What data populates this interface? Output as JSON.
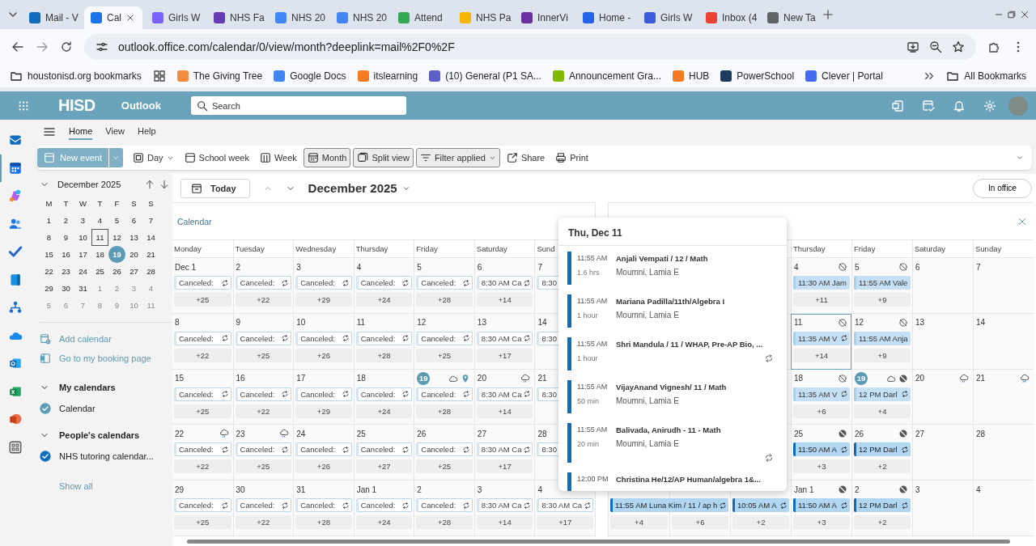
{
  "browser": {
    "tabs": [
      {
        "title": "Mail - V",
        "color": "#0f6cbd",
        "selected": false
      },
      {
        "title": "Cal",
        "color": "#1a73e8",
        "selected": true
      },
      {
        "title": "Girls W",
        "color": "#7b61ff",
        "selected": false
      },
      {
        "title": "NHS Fa",
        "color": "#673ab7",
        "selected": false
      },
      {
        "title": "NHS 20",
        "color": "#4285f4",
        "selected": false
      },
      {
        "title": "NHS 20",
        "color": "#4285f4",
        "selected": false
      },
      {
        "title": "Attend",
        "color": "#34a853",
        "selected": false
      },
      {
        "title": "NHS Pa",
        "color": "#f4b400",
        "selected": false
      },
      {
        "title": "InnerVi",
        "color": "#6b2fa0",
        "selected": false
      },
      {
        "title": "Home -",
        "color": "#2563eb",
        "selected": false
      },
      {
        "title": "Girls W",
        "color": "#3b5bdb",
        "selected": false
      },
      {
        "title": "Inbox (4",
        "color": "#ea4335",
        "selected": false
      },
      {
        "title": "New Ta",
        "color": "#5f6368",
        "selected": false
      }
    ],
    "url": "outlook.office.com/calendar/0/view/month?deeplink=mail%2F0%2F",
    "bookmarks": [
      {
        "kind": "folder",
        "label": "houstonisd.org bookmarks"
      },
      {
        "kind": "apps"
      },
      {
        "kind": "site",
        "label": "The Giving Tree",
        "color": "#f28b3c"
      },
      {
        "kind": "site",
        "label": "Google Docs",
        "color": "#4285f4"
      },
      {
        "kind": "site",
        "label": "itslearning",
        "color": "#f47b20"
      },
      {
        "kind": "site",
        "label": "(10) General (P1 SA...",
        "color": "#5b5fc7"
      },
      {
        "kind": "site",
        "label": "Announcement Gra...",
        "color": "#7fba00"
      },
      {
        "kind": "site",
        "label": "HUB",
        "color": "#f47b20"
      },
      {
        "kind": "site",
        "label": "PowerSchool",
        "color": "#1f3a5f"
      },
      {
        "kind": "site",
        "label": "Clever | Portal",
        "color": "#436cf2"
      }
    ],
    "all_bookmarks": "All Bookmarks"
  },
  "header": {
    "logo": "HISD",
    "app": "Outlook",
    "search_placeholder": "Search"
  },
  "rail": [
    {
      "kind": "mail",
      "selected": false
    },
    {
      "kind": "calendar",
      "selected": true
    },
    {
      "kind": "copilot",
      "selected": false
    },
    {
      "kind": "people",
      "selected": false
    },
    {
      "kind": "todo",
      "selected": false
    },
    {
      "kind": "book",
      "selected": false
    },
    {
      "kind": "org",
      "selected": false
    },
    {
      "kind": "onedrive",
      "selected": false
    },
    {
      "kind": "outlook",
      "selected": false
    },
    {
      "kind": "excel",
      "selected": false
    },
    {
      "kind": "powerpoint",
      "selected": false
    },
    {
      "kind": "apps",
      "selected": false
    }
  ],
  "ribbon_tabs": [
    {
      "label": "Home",
      "selected": true
    },
    {
      "label": "View",
      "selected": false
    },
    {
      "label": "Help",
      "selected": false
    }
  ],
  "toolbar": {
    "new_event": "New event",
    "items": [
      {
        "label": "Day",
        "kind": "day",
        "dropdown": true,
        "selected": false
      },
      {
        "label": "School week",
        "kind": "schoolweek",
        "dropdown": false,
        "selected": false
      },
      {
        "label": "Week",
        "kind": "week",
        "dropdown": false,
        "selected": false
      },
      {
        "label": "Month",
        "kind": "month",
        "dropdown": false,
        "selected": true
      },
      {
        "label": "Split view",
        "kind": "split",
        "dropdown": false,
        "selected": true
      },
      {
        "label": "Filter applied",
        "kind": "filter",
        "dropdown": true,
        "selected": true
      },
      {
        "label": "Share",
        "kind": "share",
        "dropdown": false,
        "selected": false
      },
      {
        "label": "Print",
        "kind": "print",
        "dropdown": false,
        "selected": false
      }
    ]
  },
  "mini_calendar": {
    "title": "December 2025",
    "weekdays": [
      "M",
      "T",
      "W",
      "T",
      "F",
      "S",
      "S"
    ],
    "weeks": [
      [
        {
          "day": "1",
          "outside": false,
          "today": false,
          "selected": false
        },
        {
          "day": "2",
          "outside": false,
          "today": false,
          "selected": false
        },
        {
          "day": "3",
          "outside": false,
          "today": false,
          "selected": false
        },
        {
          "day": "4",
          "outside": false,
          "today": false,
          "selected": false
        },
        {
          "day": "5",
          "outside": false,
          "today": false,
          "selected": false
        },
        {
          "day": "6",
          "outside": false,
          "today": false,
          "selected": false
        },
        {
          "day": "7",
          "outside": false,
          "today": false,
          "selected": false
        }
      ],
      [
        {
          "day": "8",
          "outside": false,
          "today": false,
          "selected": false
        },
        {
          "day": "9",
          "outside": false,
          "today": false,
          "selected": false
        },
        {
          "day": "10",
          "outside": false,
          "today": false,
          "selected": false
        },
        {
          "day": "11",
          "outside": false,
          "today": false,
          "selected": true
        },
        {
          "day": "12",
          "outside": false,
          "today": false,
          "selected": false
        },
        {
          "day": "13",
          "outside": false,
          "today": false,
          "selected": false
        },
        {
          "day": "14",
          "outside": false,
          "today": false,
          "selected": false
        }
      ],
      [
        {
          "day": "15",
          "outside": false,
          "today": false,
          "selected": false
        },
        {
          "day": "16",
          "outside": false,
          "today": false,
          "selected": false
        },
        {
          "day": "17",
          "outside": false,
          "today": false,
          "selected": false
        },
        {
          "day": "18",
          "outside": false,
          "today": false,
          "selected": false
        },
        {
          "day": "19",
          "outside": false,
          "today": true,
          "selected": false
        },
        {
          "day": "20",
          "outside": false,
          "today": false,
          "selected": false
        },
        {
          "day": "21",
          "outside": false,
          "today": false,
          "selected": false
        }
      ],
      [
        {
          "day": "22",
          "outside": false,
          "today": false,
          "selected": false
        },
        {
          "day": "23",
          "outside": false,
          "today": false,
          "selected": false
        },
        {
          "day": "24",
          "outside": false,
          "today": false,
          "selected": false
        },
        {
          "day": "25",
          "outside": false,
          "today": false,
          "selected": false
        },
        {
          "day": "26",
          "outside": false,
          "today": false,
          "selected": false
        },
        {
          "day": "27",
          "outside": false,
          "today": false,
          "selected": false
        },
        {
          "day": "28",
          "outside": false,
          "today": false,
          "selected": false
        }
      ],
      [
        {
          "day": "29",
          "outside": false,
          "today": false,
          "selected": false
        },
        {
          "day": "30",
          "outside": false,
          "today": false,
          "selected": false
        },
        {
          "day": "31",
          "outside": false,
          "today": false,
          "selected": false
        },
        {
          "day": "1",
          "outside": true,
          "today": false,
          "selected": false
        },
        {
          "day": "2",
          "outside": true,
          "today": false,
          "selected": false
        },
        {
          "day": "3",
          "outside": true,
          "today": false,
          "selected": false
        },
        {
          "day": "4",
          "outside": true,
          "today": false,
          "selected": false
        }
      ],
      [
        {
          "day": "5",
          "outside": true,
          "today": false,
          "selected": false
        },
        {
          "day": "6",
          "outside": true,
          "today": false,
          "selected": false
        },
        {
          "day": "7",
          "outside": true,
          "today": false,
          "selected": false
        },
        {
          "day": "8",
          "outside": true,
          "today": false,
          "selected": false
        },
        {
          "day": "9",
          "outside": true,
          "today": false,
          "selected": false
        },
        {
          "day": "10",
          "outside": true,
          "today": false,
          "selected": false
        },
        {
          "day": "11",
          "outside": true,
          "today": false,
          "selected": false
        }
      ]
    ]
  },
  "links": [
    {
      "label": "Add calendar",
      "kind": "addcal"
    },
    {
      "label": "Go to my booking page",
      "kind": "booking"
    }
  ],
  "calendar_groups": [
    {
      "title": "My calendars",
      "expanded": true,
      "calendars": [
        {
          "name": "Calendar",
          "checked": true,
          "color": "#5b9bb4"
        }
      ]
    },
    {
      "title": "People's calendars",
      "expanded": true,
      "calendars": [
        {
          "name": "NHS tutoring calendar...",
          "checked": true,
          "color": "#0f6cbd"
        }
      ]
    }
  ],
  "show_all": "Show all",
  "main": {
    "today": "Today",
    "title": "December 2025",
    "status": "In office"
  },
  "left_panel": {
    "label": "Calendar",
    "weekdays": [
      "Monday",
      "Tuesday",
      "Wednesday",
      "Thursday",
      "Friday",
      "Saturday",
      "Sund"
    ],
    "weeks": [
      [
        {
          "day": "Dec 1",
          "today": false,
          "selected": false,
          "event": {
            "text": "Canceled:",
            "kind": "outline",
            "recurring": true
          },
          "more": "+25"
        },
        {
          "day": "2",
          "today": false,
          "selected": false,
          "event": {
            "text": "Canceled:",
            "kind": "outline",
            "recurring": true
          },
          "more": "+22"
        },
        {
          "day": "3",
          "today": false,
          "selected": false,
          "event": {
            "text": "Canceled:",
            "kind": "outline",
            "recurring": true
          },
          "more": "+29"
        },
        {
          "day": "4",
          "today": false,
          "selected": false,
          "event": {
            "text": "Canceled:",
            "kind": "outline",
            "recurring": true
          },
          "more": "+24"
        },
        {
          "day": "5",
          "today": false,
          "selected": false,
          "event": {
            "text": "Canceled:",
            "kind": "outline",
            "recurring": true
          },
          "more": "+28"
        },
        {
          "day": "6",
          "today": false,
          "selected": false,
          "event": {
            "text": "8:30 AM Ca",
            "kind": "outline",
            "recurring": true
          },
          "more": "+14"
        },
        {
          "day": "7",
          "today": false,
          "selected": false,
          "event": {
            "text": "8:30",
            "kind": "outline"
          }
        }
      ],
      [
        {
          "day": "8",
          "today": false,
          "selected": false,
          "event": {
            "text": "Canceled:",
            "kind": "outline",
            "recurring": true
          },
          "more": "+22"
        },
        {
          "day": "9",
          "today": false,
          "selected": false,
          "event": {
            "text": "Canceled:",
            "kind": "outline",
            "recurring": true
          },
          "more": "+25"
        },
        {
          "day": "10",
          "today": false,
          "selected": false,
          "event": {
            "text": "Canceled:",
            "kind": "outline",
            "recurring": true
          },
          "more": "+26"
        },
        {
          "day": "11",
          "today": false,
          "selected": false,
          "event": {
            "text": "Canceled:",
            "kind": "outline",
            "recurring": true
          },
          "more": "+28"
        },
        {
          "day": "12",
          "today": false,
          "selected": false,
          "event": {
            "text": "Canceled:",
            "kind": "outline",
            "recurring": true
          },
          "more": "+25"
        },
        {
          "day": "13",
          "today": false,
          "selected": false,
          "event": {
            "text": "8:30 AM Ca",
            "kind": "outline",
            "recurring": true
          },
          "more": "+17"
        },
        {
          "day": "14",
          "today": false,
          "selected": false,
          "event": {
            "text": "8:30",
            "kind": "outline"
          }
        }
      ],
      [
        {
          "day": "15",
          "today": false,
          "selected": false,
          "event": {
            "text": "Canceled:",
            "kind": "outline",
            "recurring": true
          },
          "more": "+25"
        },
        {
          "day": "16",
          "today": false,
          "selected": false,
          "event": {
            "text": "Canceled:",
            "kind": "outline",
            "recurring": true
          },
          "more": "+22"
        },
        {
          "day": "17",
          "today": false,
          "selected": false,
          "event": {
            "text": "Canceled:",
            "kind": "outline",
            "recurring": true
          },
          "more": "+29"
        },
        {
          "day": "18",
          "today": false,
          "selected": false,
          "event": {
            "text": "Canceled:",
            "kind": "outline",
            "recurring": true
          },
          "more": "+24"
        },
        {
          "day": "19",
          "today": true,
          "selected": false,
          "icons": [
            {
              "kind": "cloud"
            },
            {
              "kind": "pin"
            }
          ],
          "event": {
            "text": "Canceled:",
            "kind": "outline",
            "recurring": true
          },
          "more": "+28"
        },
        {
          "day": "20",
          "today": false,
          "selected": false,
          "icons": [
            {
              "kind": "rain"
            }
          ],
          "event": {
            "text": "8:30 AM Ca",
            "kind": "outline",
            "recurring": true
          },
          "more": "+14"
        },
        {
          "day": "21",
          "today": false,
          "selected": false,
          "event": {
            "text": "8:30",
            "kind": "outline"
          }
        }
      ],
      [
        {
          "day": "22",
          "today": false,
          "selected": false,
          "icons": [
            {
              "kind": "rain"
            }
          ],
          "event": {
            "text": "Canceled:",
            "kind": "outline",
            "recurring": true
          },
          "more": "+22"
        },
        {
          "day": "23",
          "today": false,
          "selected": false,
          "icons": [
            {
              "kind": "rain"
            }
          ],
          "event": {
            "text": "Canceled:",
            "kind": "outline",
            "recurring": true
          },
          "more": "+25"
        },
        {
          "day": "24",
          "today": false,
          "selected": false,
          "event": {
            "text": "Canceled:",
            "kind": "outline",
            "recurring": true
          },
          "more": "+26"
        },
        {
          "day": "25",
          "today": false,
          "selected": false,
          "event": {
            "text": "Canceled:",
            "kind": "outline",
            "recurring": true
          },
          "more": "+27"
        },
        {
          "day": "26",
          "today": false,
          "selected": false,
          "event": {
            "text": "Canceled:",
            "kind": "outline",
            "recurring": true
          },
          "more": "+25"
        },
        {
          "day": "27",
          "today": false,
          "selected": false,
          "event": {
            "text": "8:30 AM Ca",
            "kind": "outline",
            "recurring": true
          },
          "more": "+17"
        },
        {
          "day": "28",
          "today": false,
          "selected": false,
          "event": {
            "text": "8:30",
            "kind": "outline"
          }
        }
      ],
      [
        {
          "day": "29",
          "today": false,
          "selected": false,
          "event": {
            "text": "Canceled:",
            "kind": "outline",
            "recurring": true
          },
          "more": "+25"
        },
        {
          "day": "30",
          "today": false,
          "selected": false,
          "event": {
            "text": "Canceled:",
            "kind": "outline",
            "recurring": true
          },
          "more": "+22"
        },
        {
          "day": "31",
          "today": false,
          "selected": false,
          "event": {
            "text": "Canceled:",
            "kind": "outline",
            "recurring": true
          },
          "more": "+28"
        },
        {
          "day": "Jan 1",
          "today": false,
          "selected": false,
          "event": {
            "text": "Canceled:",
            "kind": "outline",
            "recurring": true
          },
          "more": "+24"
        },
        {
          "day": "2",
          "today": false,
          "selected": false,
          "event": {
            "text": "Canceled:",
            "kind": "outline",
            "recurring": true
          },
          "more": "+28"
        },
        {
          "day": "3",
          "today": false,
          "selected": false,
          "event": {
            "text": "8:30 AM Ca",
            "kind": "outline",
            "recurring": true
          },
          "more": "+14"
        },
        {
          "day": "4",
          "today": false,
          "selected": false,
          "event": {
            "text": "8:30 AM Ca",
            "kind": "outline",
            "recurring": true
          },
          "more": "+17"
        }
      ]
    ]
  },
  "right_panel": {
    "weekdays": [
      "Thursday",
      "Friday",
      "Saturday",
      "Sunday"
    ],
    "weeks": [
      [
        {
          "day": "4",
          "today": false,
          "selected": false,
          "icons": [
            {
              "kind": "blocked"
            }
          ],
          "event": {
            "text": "11:30 AM Jam",
            "kind": "light"
          },
          "more": "+11"
        },
        {
          "day": "5",
          "today": false,
          "selected": false,
          "icons": [
            {
              "kind": "blocked"
            }
          ],
          "event": {
            "text": "11:55 AM Vale",
            "kind": "light"
          },
          "more": "+9"
        },
        {
          "day": "6",
          "today": false,
          "selected": false
        },
        {
          "day": "7",
          "today": false,
          "selected": false
        }
      ],
      [
        {
          "day": "11",
          "today": false,
          "selected": true,
          "icons": [
            {
              "kind": "blocked"
            }
          ],
          "event": {
            "text": "11:35 AM V",
            "kind": "light",
            "recurring": true
          },
          "more": "+14"
        },
        {
          "day": "12",
          "today": false,
          "selected": false,
          "icons": [
            {
              "kind": "blocked"
            }
          ],
          "event": {
            "text": "11:55 AM Anja",
            "kind": "light"
          },
          "more": "+9"
        },
        {
          "day": "13",
          "today": false,
          "selected": false
        },
        {
          "day": "14",
          "today": false,
          "selected": false
        }
      ],
      [
        {
          "day": "18",
          "today": false,
          "selected": false,
          "icons": [
            {
              "kind": "blocked"
            }
          ],
          "event": {
            "text": "11:35 AM V",
            "kind": "light",
            "recurring": true
          },
          "more": "+6"
        },
        {
          "day": "19",
          "today": true,
          "selected": false,
          "icons": [
            {
              "kind": "cloud"
            },
            {
              "kind": "blockedfill"
            }
          ],
          "event": {
            "text": "12 PM Darl",
            "kind": "light",
            "recurring": true
          },
          "more": "+4"
        },
        {
          "day": "20",
          "today": false,
          "selected": false,
          "icons": [
            {
              "kind": "rain"
            }
          ]
        },
        {
          "day": "21",
          "today": false,
          "selected": false,
          "icons": [
            {
              "kind": "rain"
            }
          ]
        }
      ],
      [
        {
          "day": "25",
          "today": false,
          "selected": false,
          "icons": [
            {
              "kind": "blockedfill"
            }
          ],
          "event": {
            "text": "11:50 AM A",
            "kind": "solid",
            "recurring": true
          },
          "more": "+3"
        },
        {
          "day": "26",
          "today": false,
          "selected": false,
          "icons": [
            {
              "kind": "blockedfill"
            }
          ],
          "event": {
            "text": "12 PM Darl",
            "kind": "solid",
            "recurring": true
          },
          "more": "+2"
        },
        {
          "day": "27",
          "today": false,
          "selected": false
        },
        {
          "day": "28",
          "today": false,
          "selected": false
        }
      ],
      [
        {
          "selected": false,
          "event": {
            "text": "11:55 AM Luna Kim / 11 / ap h",
            "kind": "solid",
            "recurring": true,
            "wide": true
          },
          "more": "+4"
        },
        {
          "selected": false,
          "more": "+6"
        },
        {
          "selected": false,
          "event": {
            "text": "10:05 AM A",
            "kind": "solid",
            "recurring": true
          },
          "more": "+2"
        },
        {
          "day": "Jan 1",
          "today": false,
          "selected": false,
          "icons": [
            {
              "kind": "blockedfill"
            }
          ],
          "event": {
            "text": "11:50 AM A",
            "kind": "solid",
            "recurring": true
          },
          "more": "+3"
        },
        {
          "day": "2",
          "today": false,
          "selected": false,
          "icons": [
            {
              "kind": "blockedfill"
            }
          ],
          "event": {
            "text": "12 PM Darl",
            "kind": "solid",
            "recurring": true
          },
          "more": "+2"
        },
        {
          "day": "3",
          "today": false,
          "selected": false
        },
        {
          "day": "4",
          "today": false,
          "selected": false
        }
      ]
    ]
  },
  "popup": {
    "title": "Thu, Dec 11",
    "events": [
      {
        "time": "11:55 AM",
        "duration": "1.6 hrs",
        "title": "Anjali Vempati / 12 / Math",
        "organizer": "Moumni, Lamia E",
        "recurring": false
      },
      {
        "time": "11:55 AM",
        "duration": "1 hour",
        "title": "Mariana Padilla/11th/Algebra I",
        "organizer": "Moumni, Lamia E",
        "recurring": false
      },
      {
        "time": "11:55 AM",
        "duration": "1 hour",
        "title": "Shri Mandula / 11 / WHAP, Pre-AP Bio, ...",
        "recurring": true
      },
      {
        "time": "11:55 AM",
        "duration": "50 min",
        "title": "VijayAnand Vignesh/ 11 / Math",
        "organizer": "Moumni, Lamia E",
        "recurring": false
      },
      {
        "time": "11:55 AM",
        "duration": "20 min",
        "title": "Balivada, Anirudh - 11 - Math",
        "organizer": "Moumni, Lamia E",
        "recurring": true
      },
      {
        "time": "12:00 PM",
        "title": "Christina He/12/AP Human/algebra 1&...",
        "recurring": false
      }
    ]
  }
}
